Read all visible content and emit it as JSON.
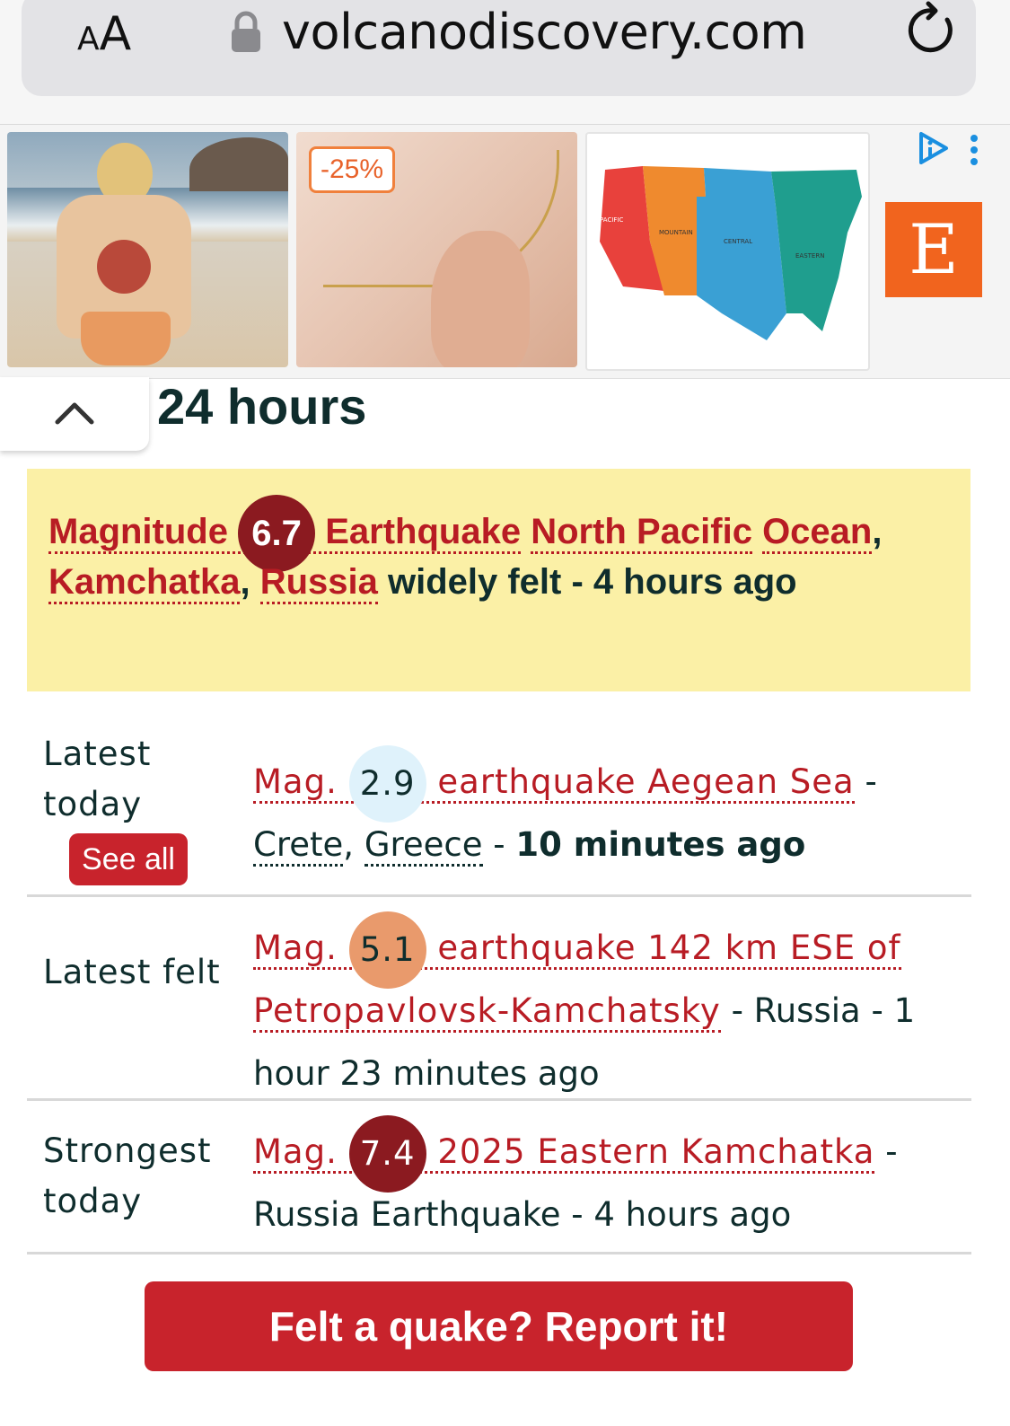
{
  "browser": {
    "aa_label_small": "A",
    "aa_label_large": "A",
    "url": "volcanodiscovery.com"
  },
  "ads": {
    "discount_badge": "-25%",
    "etsy_logo": "E",
    "map_labels": [
      "PACIFIC",
      "MOUNTAIN",
      "CENTRAL",
      "EASTERN"
    ]
  },
  "section": {
    "title": "24 hours"
  },
  "alert": {
    "prefix": "Magnitude",
    "magnitude": "6.7",
    "magnitude_color": "#8b1a20",
    "quake_word": "Earthquake",
    "region_a": "North Pacific",
    "region_b": "Ocean",
    "sep1": ",",
    "place": "Kamchatka",
    "sep2": ",",
    "country": "Russia",
    "suffix": "widely felt - 4 hours ago"
  },
  "rows": [
    {
      "label": "Latest today",
      "mag_prefix": "Mag.",
      "magnitude": "2.9",
      "circle_color": "#dff2fb",
      "title": "earthquake Aegean Sea",
      "dash1": " -",
      "region": "Crete",
      "comma": ",",
      "country": "Greece",
      "dash2": " - ",
      "time": "10 minutes ago",
      "button": "See all"
    },
    {
      "label": "Latest felt",
      "mag_prefix": "Mag.",
      "magnitude": "5.1",
      "circle_color": "#e99a6c",
      "title_a": "earthquake 142 km ESE of",
      "title_b": "Petropavlovsk-Kamchatsky",
      "rest": " - Russia - 1 hour 23 minutes ago"
    },
    {
      "label": "Strongest today",
      "mag_prefix": "Mag.",
      "magnitude": "7.4",
      "circle_color": "#8b1a20",
      "title": "2025 Eastern Kamchatka",
      "rest": " - Russia Earthquake - 4 hours ago"
    }
  ],
  "report_button": "Felt a quake? Report it!",
  "colors": {
    "accent_red": "#c8232c",
    "link_red": "#b81c24",
    "alert_bg": "#fbf0a6",
    "text_dark": "#0f2d2d"
  }
}
